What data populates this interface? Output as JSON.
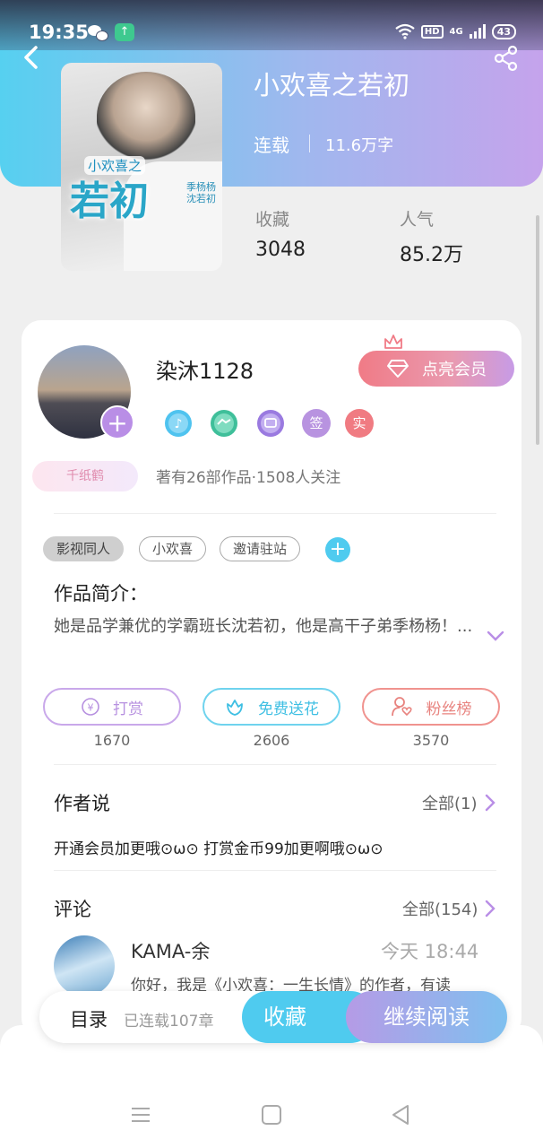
{
  "status_bar": {
    "time": "19:35",
    "left_icons": [
      "wechat-icon",
      "app-update-icon"
    ],
    "hd": "HD",
    "network": "4G",
    "battery": "43"
  },
  "book": {
    "title": "小欢喜之若初",
    "status": "连载",
    "word_count": "11.6万字",
    "cover": {
      "series": "小欢喜之",
      "title": "若初",
      "side_text": "季杨杨\n沈若初"
    },
    "stats": {
      "favorites_label": "收藏",
      "favorites_value": "3048",
      "popularity_label": "人气",
      "popularity_value": "85.2万"
    }
  },
  "author": {
    "name": "染沐1128",
    "vip_label": "点亮会员",
    "badges": [
      "music-medal-icon",
      "handshake-medal-icon",
      "chat-medal-icon"
    ],
    "badge_sign": "签",
    "badge_real": "实",
    "crane_tag": "千纸鹤",
    "meta": "著有26部作品·1508人关注"
  },
  "tags": [
    "影视同人",
    "小欢喜",
    "邀请驻站"
  ],
  "intro": {
    "heading": "作品简介：",
    "text": "她是品学兼优的学霸班长沈若初，他是高干子弟季杨杨！..."
  },
  "actions": [
    {
      "label": "打赏",
      "count": "1670",
      "icon": "yen-icon"
    },
    {
      "label": "免费送花",
      "count": "2606",
      "icon": "flower-icon"
    },
    {
      "label": "粉丝榜",
      "count": "3570",
      "icon": "fan-heart-icon"
    }
  ],
  "author_says": {
    "heading": "作者说",
    "more": "全部(1)",
    "text": "开通会员加更哦⊙ω⊙ 打赏金币99加更啊哦⊙ω⊙"
  },
  "comments": {
    "heading": "评论",
    "more": "全部(154)",
    "items": [
      {
        "user": "KAMA-余",
        "time": "今天 18:44",
        "text": "你好，我是《小欢喜：一生长情》的作者，有读"
      }
    ]
  },
  "bottom_bar": {
    "toc": "目录",
    "chapters": "已连载107章",
    "collect": "收藏",
    "read": "继续阅读"
  },
  "colors": {
    "header_start": "#56d0f0",
    "header_end": "#c5a3ec",
    "cyan": "#4fcbef",
    "purple": "#b98ee6",
    "coral": "#f07b86"
  }
}
